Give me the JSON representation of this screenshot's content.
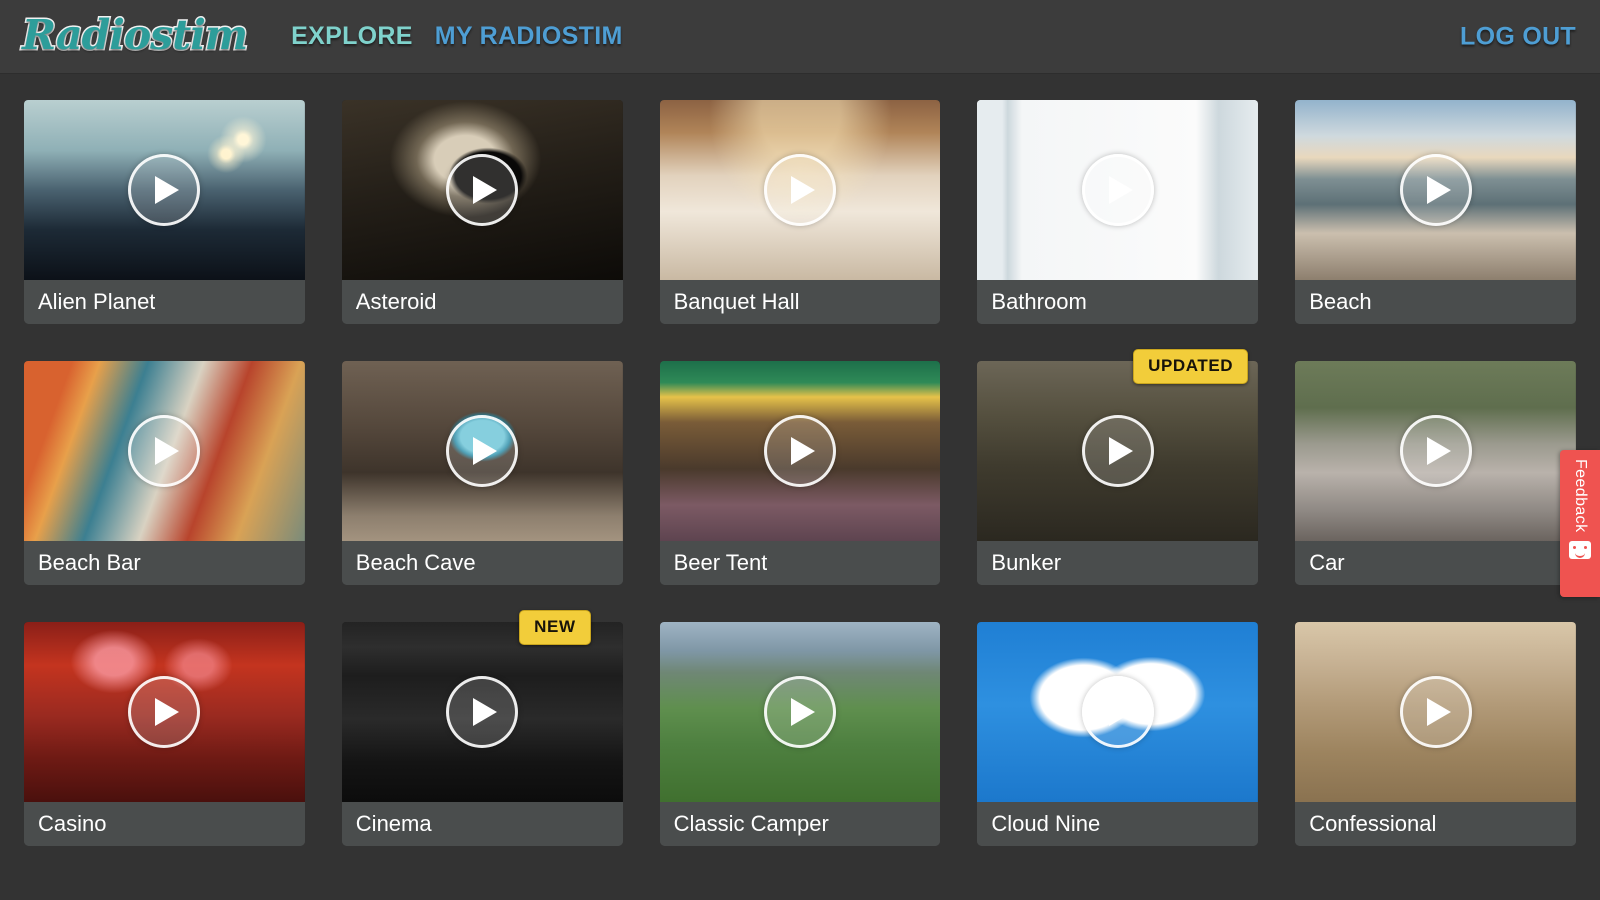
{
  "header": {
    "logo": "Radiostim",
    "nav": [
      {
        "label": "EXPLORE",
        "name": "nav-explore"
      },
      {
        "label": "MY RADIOSTIM",
        "name": "nav-my-radiostim"
      }
    ],
    "logout_label": "LOG OUT"
  },
  "colors": {
    "page_background": "#333333",
    "header_background": "#3c3c3c",
    "card_background": "#4a4d4d",
    "accent_teal": "#7fd2cc",
    "accent_blue": "#4e9ed4",
    "logo_teal": "#2d9d9a",
    "badge_yellow": "#f2cd3a",
    "feedback_red": "#ef5350",
    "card_title_text": "#ffffff"
  },
  "feedback": {
    "label": "Feedback",
    "icon": "smiley-speech-bubble-icon"
  },
  "grid": {
    "play_icon": "play-icon",
    "cards": [
      {
        "title": "Alien Planet",
        "badge": null,
        "thumb": "alien-planet-thumbnail"
      },
      {
        "title": "Asteroid",
        "badge": null,
        "thumb": "asteroid-thumbnail"
      },
      {
        "title": "Banquet Hall",
        "badge": null,
        "thumb": "banquet-hall-thumbnail"
      },
      {
        "title": "Bathroom",
        "badge": null,
        "thumb": "bathroom-thumbnail"
      },
      {
        "title": "Beach",
        "badge": null,
        "thumb": "beach-thumbnail"
      },
      {
        "title": "Beach Bar",
        "badge": null,
        "thumb": "beach-bar-thumbnail"
      },
      {
        "title": "Beach Cave",
        "badge": null,
        "thumb": "beach-cave-thumbnail"
      },
      {
        "title": "Beer Tent",
        "badge": null,
        "thumb": "beer-tent-thumbnail"
      },
      {
        "title": "Bunker",
        "badge": "UPDATED",
        "thumb": "bunker-thumbnail"
      },
      {
        "title": "Car",
        "badge": null,
        "thumb": "car-thumbnail"
      },
      {
        "title": "Casino",
        "badge": null,
        "thumb": "casino-thumbnail"
      },
      {
        "title": "Cinema",
        "badge": "NEW",
        "thumb": "cinema-thumbnail"
      },
      {
        "title": "Classic Camper",
        "badge": null,
        "thumb": "classic-camper-thumbnail"
      },
      {
        "title": "Cloud Nine",
        "badge": null,
        "thumb": "cloud-nine-thumbnail"
      },
      {
        "title": "Confessional",
        "badge": null,
        "thumb": "confessional-thumbnail"
      }
    ]
  }
}
